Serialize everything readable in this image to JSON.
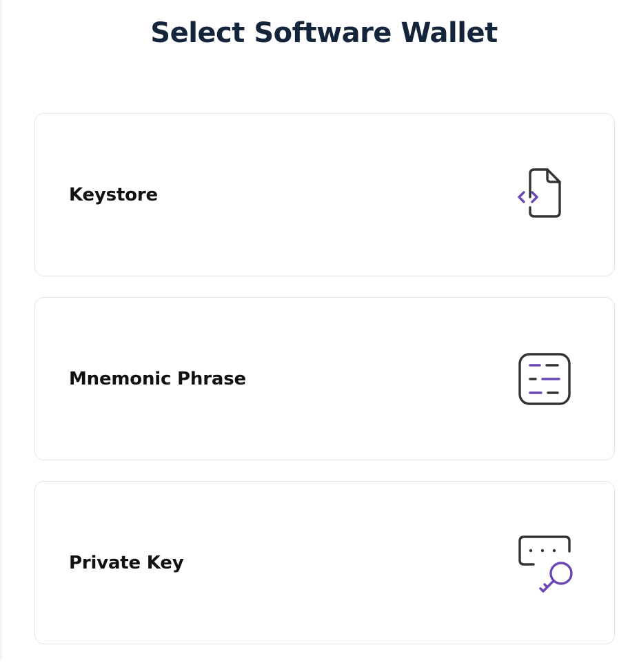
{
  "page": {
    "title": "Select Software Wallet"
  },
  "options": [
    {
      "label": "Keystore",
      "icon": "file-code-icon"
    },
    {
      "label": "Mnemonic Phrase",
      "icon": "mnemonic-list-icon"
    },
    {
      "label": "Private Key",
      "icon": "password-key-icon"
    }
  ],
  "colors": {
    "title": "#14253b",
    "label": "#111111",
    "icon_stroke": "#333333",
    "icon_accent": "#6b46b5",
    "card_border": "#e2e4e8"
  }
}
